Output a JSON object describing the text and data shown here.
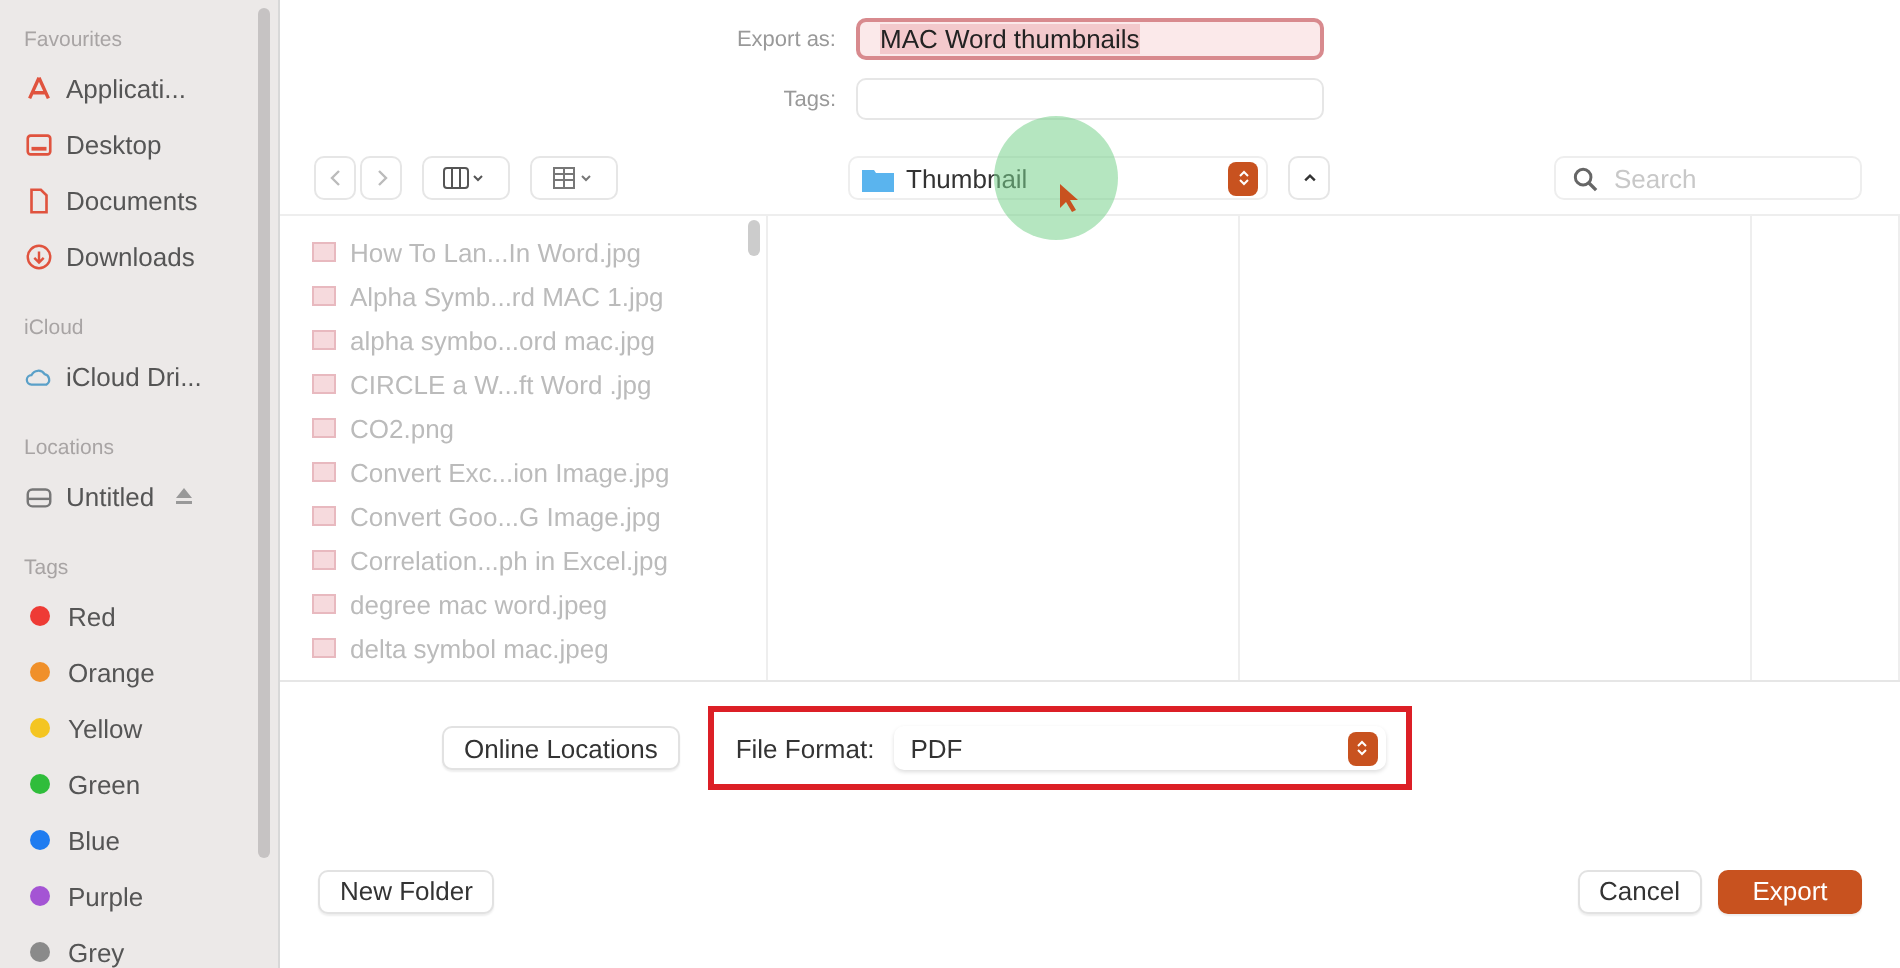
{
  "sidebar": {
    "sections": [
      {
        "title": "Favourites",
        "items": [
          {
            "label": "Applicati..."
          },
          {
            "label": "Desktop"
          },
          {
            "label": "Documents"
          },
          {
            "label": "Downloads"
          }
        ]
      },
      {
        "title": "iCloud",
        "items": [
          {
            "label": "iCloud Dri..."
          }
        ]
      },
      {
        "title": "Locations",
        "items": [
          {
            "label": "Untitled",
            "eject": true
          }
        ]
      },
      {
        "title": "Tags",
        "items": [
          {
            "label": "Red",
            "color": "#ee3b35"
          },
          {
            "label": "Orange",
            "color": "#f0902a"
          },
          {
            "label": "Yellow",
            "color": "#f4c521"
          },
          {
            "label": "Green",
            "color": "#2fbd3b"
          },
          {
            "label": "Blue",
            "color": "#1f7cf0"
          },
          {
            "label": "Purple",
            "color": "#a454d4"
          },
          {
            "label": "Grey",
            "color": "#8a8a8a"
          }
        ]
      }
    ]
  },
  "export_as": {
    "label": "Export as:",
    "value": "MAC Word thumbnails"
  },
  "tags": {
    "label": "Tags:"
  },
  "location": {
    "label": "Thumbnail"
  },
  "search": {
    "placeholder": "Search"
  },
  "files": [
    {
      "name": "How To Lan...In Word.jpg"
    },
    {
      "name": "Alpha Symb...rd MAC 1.jpg"
    },
    {
      "name": "alpha symbo...ord mac.jpg"
    },
    {
      "name": "CIRCLE a W...ft Word   .jpg"
    },
    {
      "name": "CO2.png"
    },
    {
      "name": "Convert Exc...ion Image.jpg"
    },
    {
      "name": "Convert Goo...G Image.jpg"
    },
    {
      "name": "Correlation...ph in Excel.jpg"
    },
    {
      "name": "degree mac word.jpeg"
    },
    {
      "name": "delta symbol mac.jpeg"
    }
  ],
  "online_locations": "Online Locations",
  "file_format": {
    "label": "File Format:",
    "value": "PDF"
  },
  "buttons": {
    "new_folder": "New Folder",
    "cancel": "Cancel",
    "export": "Export"
  }
}
